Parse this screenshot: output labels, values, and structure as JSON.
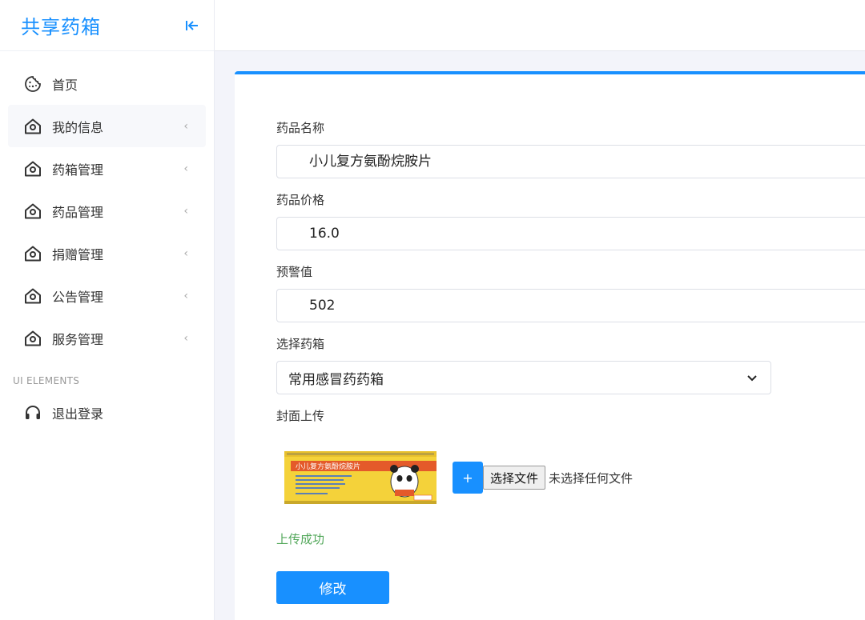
{
  "brand": {
    "title": "共享药箱"
  },
  "sidebar": {
    "items": [
      {
        "label": "首页",
        "icon": "cookie-icon",
        "has_submenu": false
      },
      {
        "label": "我的信息",
        "icon": "home-icon",
        "has_submenu": true
      },
      {
        "label": "药箱管理",
        "icon": "home-icon",
        "has_submenu": true
      },
      {
        "label": "药品管理",
        "icon": "home-icon",
        "has_submenu": true
      },
      {
        "label": "捐赠管理",
        "icon": "home-icon",
        "has_submenu": true
      },
      {
        "label": "公告管理",
        "icon": "home-icon",
        "has_submenu": true
      },
      {
        "label": "服务管理",
        "icon": "home-icon",
        "has_submenu": true
      }
    ],
    "section_title": "UI ELEMENTS",
    "logout": {
      "label": "退出登录",
      "icon": "headset-icon"
    }
  },
  "form": {
    "name_label": "药品名称",
    "name_value": "小儿复方氨酚烷胺片",
    "price_label": "药品价格",
    "price_value": "16.0",
    "warning_label": "预警值",
    "warning_value": "502",
    "box_label": "选择药箱",
    "box_value": "常用感冒药药箱",
    "cover_label": "封面上传",
    "cover_image_text": "小儿复方氨酚烷胺片",
    "plus_label": "+",
    "file_button": "选择文件",
    "file_status": "未选择任何文件",
    "upload_status": "上传成功",
    "submit_label": "修改"
  },
  "colors": {
    "accent": "#1890ff",
    "success": "#52a75a",
    "background": "#f3f4fa"
  }
}
